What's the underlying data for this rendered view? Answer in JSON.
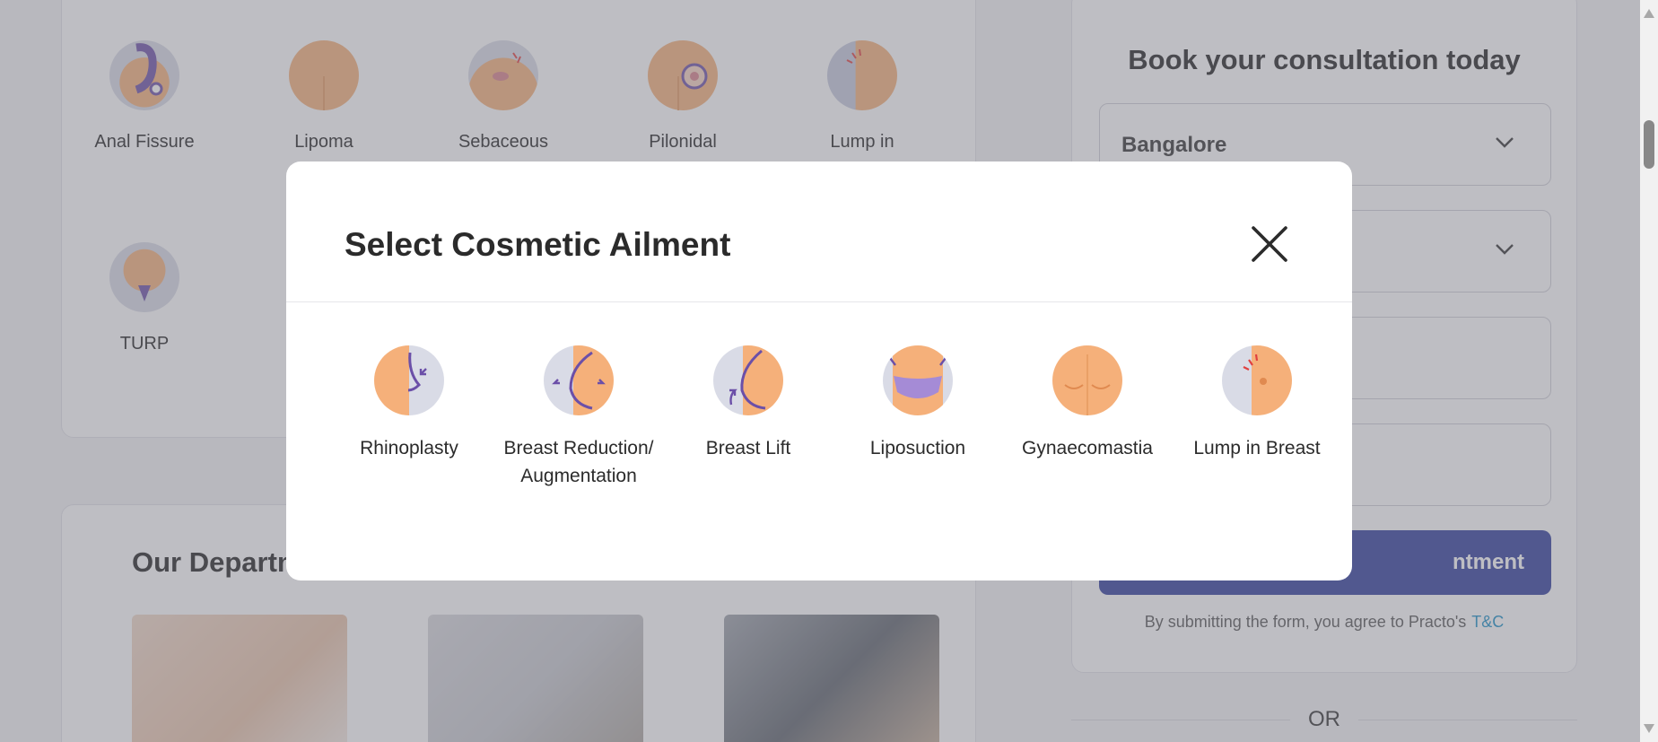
{
  "background": {
    "ailments_row1": [
      {
        "label": "Anal Fissure",
        "icon": "anal-fissure-icon"
      },
      {
        "label": "Lipoma",
        "icon": "lipoma-icon"
      },
      {
        "label": "Sebaceous",
        "icon": "sebaceous-cyst-icon"
      },
      {
        "label": "Pilonidal",
        "icon": "pilonidal-sinus-icon"
      },
      {
        "label": "Lump in",
        "icon": "lump-icon"
      }
    ],
    "ailments_row2": [
      {
        "label": "TURP",
        "icon": "turp-icon"
      }
    ],
    "departments_title": "Our Departm"
  },
  "form": {
    "title": "Book your consultation today",
    "city": "Bangalore",
    "submit_label": "ntment",
    "terms_text": "By submitting the form, you agree to Practo's",
    "terms_link": "T&C",
    "or_text": "OR"
  },
  "modal": {
    "title": "Select Cosmetic Ailment",
    "items": [
      {
        "label": "Rhinoplasty",
        "icon": "rhinoplasty-icon"
      },
      {
        "label": "Breast Reduction/ Augmentation",
        "icon": "breast-reduction-icon"
      },
      {
        "label": "Breast Lift",
        "icon": "breast-lift-icon"
      },
      {
        "label": "Liposuction",
        "icon": "liposuction-icon"
      },
      {
        "label": "Gynaecomastia",
        "icon": "gynaecomastia-icon"
      },
      {
        "label": "Lump in Breast",
        "icon": "lump-in-breast-icon"
      }
    ]
  },
  "colors": {
    "accent": "#2f3d9c",
    "link": "#1a8fc6",
    "skin": "#f5b07a",
    "illustration_purple": "#6b4fa8",
    "overlay": "rgba(120,120,130,0.48)"
  }
}
